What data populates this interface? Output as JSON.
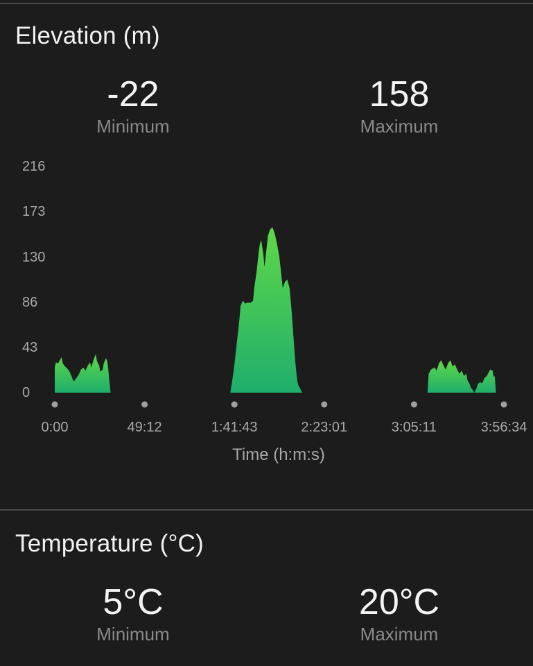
{
  "elevation": {
    "title": "Elevation (m)",
    "min_value": "-22",
    "min_label": "Minimum",
    "max_value": "158",
    "max_label": "Maximum"
  },
  "temperature": {
    "title": "Temperature (°C)",
    "min_value": "5°C",
    "min_label": "Minimum",
    "max_value": "20°C",
    "max_label": "Maximum"
  },
  "colors": {
    "background": "#1c1c1c",
    "fill_top": "#5fd848",
    "fill_bottom": "#1fae6c",
    "tick_text": "#a8a8a8",
    "divider": "#4a4a4a"
  },
  "chart_data": {
    "type": "area",
    "xlabel": "Time (h:m:s)",
    "ylabel": "",
    "x_tick_labels": [
      "0:00",
      "49:12",
      "1:41:43",
      "2:23:01",
      "3:05:11",
      "3:56:34"
    ],
    "y_tick_labels": [
      "216",
      "173",
      "130",
      "86",
      "43",
      "0"
    ],
    "ylim": [
      0,
      216
    ],
    "x_unit": "minutes",
    "segments": [
      {
        "points": [
          [
            0,
            24
          ],
          [
            1,
            29
          ],
          [
            3,
            28
          ],
          [
            5,
            32
          ],
          [
            6,
            34
          ],
          [
            7,
            28
          ],
          [
            9,
            25
          ],
          [
            11,
            23
          ],
          [
            13,
            20
          ],
          [
            15,
            15
          ],
          [
            16,
            12
          ],
          [
            17,
            11
          ],
          [
            19,
            14
          ],
          [
            21,
            17
          ],
          [
            23,
            22
          ],
          [
            25,
            24
          ],
          [
            27,
            21
          ],
          [
            29,
            26
          ],
          [
            31,
            29
          ],
          [
            32,
            24
          ],
          [
            34,
            31
          ],
          [
            36,
            37
          ],
          [
            37,
            30
          ],
          [
            39,
            26
          ],
          [
            40,
            20
          ],
          [
            42,
            22
          ],
          [
            43,
            28
          ],
          [
            45,
            33
          ],
          [
            46,
            30
          ],
          [
            47,
            22
          ],
          [
            48,
            10
          ],
          [
            49,
            0
          ]
        ]
      },
      {
        "points": [
          [
            154,
            0
          ],
          [
            157,
            21
          ],
          [
            160,
            50
          ],
          [
            162,
            70
          ],
          [
            163,
            83
          ],
          [
            165,
            88
          ],
          [
            167,
            85
          ],
          [
            169,
            86
          ],
          [
            172,
            86
          ],
          [
            174,
            88
          ],
          [
            175,
            100
          ],
          [
            177,
            115
          ],
          [
            179,
            135
          ],
          [
            180,
            142
          ],
          [
            181,
            146
          ],
          [
            183,
            132
          ],
          [
            184,
            120
          ],
          [
            185,
            130
          ],
          [
            187,
            150
          ],
          [
            189,
            156
          ],
          [
            191,
            158
          ],
          [
            193,
            152
          ],
          [
            195,
            142
          ],
          [
            197,
            130
          ],
          [
            199,
            110
          ],
          [
            200,
            100
          ],
          [
            202,
            106
          ],
          [
            204,
            108
          ],
          [
            206,
            100
          ],
          [
            207,
            88
          ],
          [
            208,
            75
          ],
          [
            209,
            60
          ],
          [
            210,
            44
          ],
          [
            211,
            30
          ],
          [
            212,
            18
          ],
          [
            213,
            10
          ],
          [
            214,
            6
          ],
          [
            215,
            5
          ],
          [
            216,
            2
          ],
          [
            217,
            0
          ]
        ]
      },
      {
        "points": [
          [
            327,
            0
          ],
          [
            328,
            18
          ],
          [
            330,
            22
          ],
          [
            333,
            24
          ],
          [
            335,
            21
          ],
          [
            337,
            28
          ],
          [
            339,
            31
          ],
          [
            341,
            26
          ],
          [
            343,
            22
          ],
          [
            345,
            28
          ],
          [
            347,
            31
          ],
          [
            349,
            25
          ],
          [
            351,
            27
          ],
          [
            353,
            22
          ],
          [
            355,
            18
          ],
          [
            357,
            21
          ],
          [
            359,
            16
          ],
          [
            361,
            18
          ],
          [
            362,
            12
          ],
          [
            364,
            8
          ],
          [
            365,
            5
          ],
          [
            367,
            2
          ],
          [
            368,
            0
          ],
          [
            370,
            4
          ],
          [
            371,
            8
          ],
          [
            373,
            10
          ],
          [
            375,
            9
          ],
          [
            377,
            14
          ],
          [
            379,
            16
          ],
          [
            380,
            18
          ],
          [
            382,
            22
          ],
          [
            384,
            21
          ],
          [
            385,
            15
          ],
          [
            386,
            16
          ],
          [
            387,
            0
          ]
        ]
      }
    ]
  }
}
